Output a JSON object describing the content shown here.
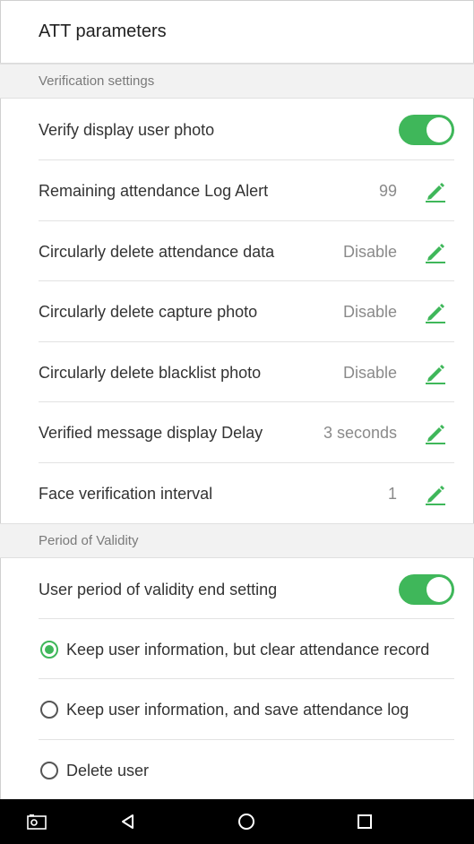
{
  "title": "ATT parameters",
  "sections": {
    "verification": {
      "header": "Verification settings",
      "verify_display_photo": {
        "label": "Verify display user photo",
        "enabled": true
      },
      "items": [
        {
          "label": "Remaining attendance Log Alert",
          "value": "99"
        },
        {
          "label": "Circularly delete attendance data",
          "value": "Disable"
        },
        {
          "label": "Circularly delete capture photo",
          "value": "Disable"
        },
        {
          "label": "Circularly delete blacklist photo",
          "value": "Disable"
        },
        {
          "label": "Verified message display Delay",
          "value": "3 seconds"
        },
        {
          "label": "Face verification interval",
          "value": "1"
        }
      ]
    },
    "validity": {
      "header": "Period of Validity",
      "end_setting": {
        "label": "User period of validity end setting",
        "enabled": true
      },
      "options": [
        {
          "label": "Keep user information, but clear attendance record",
          "selected": true
        },
        {
          "label": "Keep user information, and save attendance log",
          "selected": false
        },
        {
          "label": "Delete user",
          "selected": false
        }
      ]
    }
  },
  "colors": {
    "accent": "#3fb75a",
    "section_bg": "#f2f2f2",
    "nav_bg": "#000000"
  },
  "icons": {
    "edit": "pencil-icon",
    "nav": [
      "screenshot-icon",
      "back-icon",
      "home-icon",
      "recents-icon"
    ]
  }
}
